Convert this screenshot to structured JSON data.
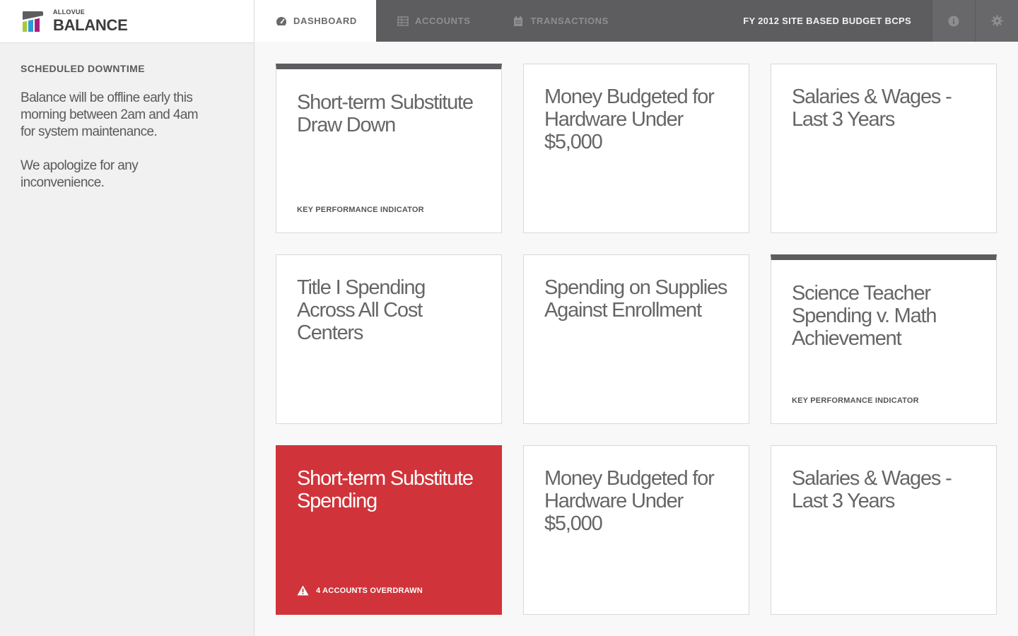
{
  "logo": {
    "brand": "ALLOVUE",
    "product": "BALANCE"
  },
  "notice": {
    "title": "SCHEDULED DOWNTIME",
    "paragraphs": [
      "Balance will be offline early this morning between 2am and 4am for system maintenance.",
      "We apologize for any inconvenience."
    ]
  },
  "nav": {
    "tabs": [
      {
        "label": "DASHBOARD",
        "icon": "gauge-icon",
        "active": true
      },
      {
        "label": "ACCOUNTS",
        "icon": "table-icon",
        "active": false
      },
      {
        "label": "TRANSACTIONS",
        "icon": "calendar-icon",
        "active": false
      }
    ],
    "budget_title": "FY 2012 SITE BASED BUDGET BCPS",
    "info_icon": "info-icon",
    "settings_icon": "gear-icon"
  },
  "cards": [
    {
      "title": "Short-term Substitute Draw Down",
      "footer": "KEY PERFORMANCE INDICATOR",
      "variant": "kpi"
    },
    {
      "title": "Money Budgeted for Hardware Under $5,000",
      "footer": "",
      "variant": "plain"
    },
    {
      "title": "Salaries & Wages - Last 3 Years",
      "footer": "",
      "variant": "plain"
    },
    {
      "title": "Title I Spending Across All Cost Centers",
      "footer": "",
      "variant": "plain"
    },
    {
      "title": "Spending on Supplies Against Enrollment",
      "footer": "",
      "variant": "plain"
    },
    {
      "title": "Science Teacher Spending v. Math Achievement",
      "footer": "KEY PERFORMANCE INDICATOR",
      "variant": "kpi"
    },
    {
      "title": "Short-term Substitute Spending",
      "footer": "4 ACCOUNTS OVERDRAWN",
      "variant": "alert",
      "footer_icon": "warning-icon"
    },
    {
      "title": "Money Budgeted for Hardware Under $5,000",
      "footer": "",
      "variant": "plain"
    },
    {
      "title": "Salaries & Wages - Last 3 Years",
      "footer": "",
      "variant": "plain"
    }
  ],
  "colors": {
    "nav_bg": "#5d5d60",
    "alert": "#d0343a",
    "kpi_bar": "#5d5d60"
  }
}
